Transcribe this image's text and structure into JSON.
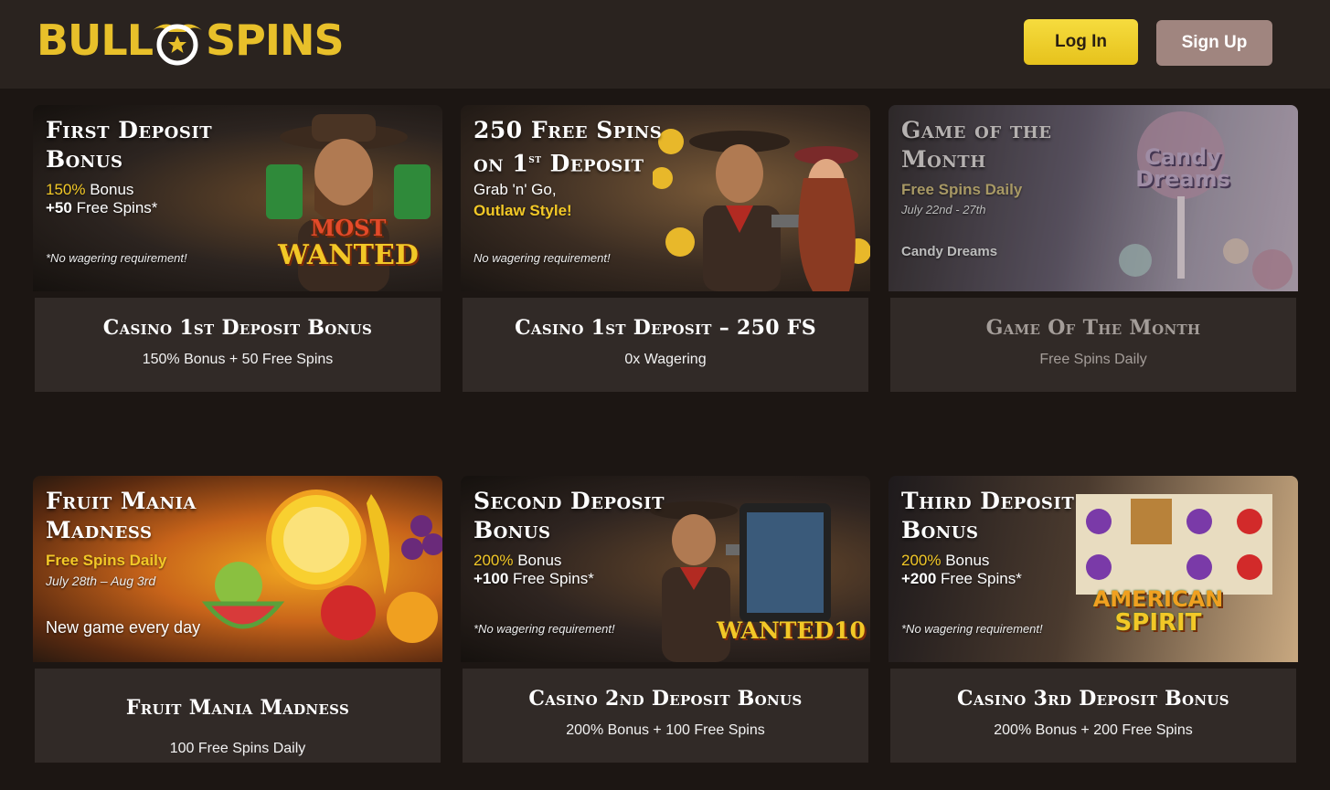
{
  "header": {
    "logo_left": "BULL",
    "logo_right": "SPINS",
    "login_label": "Log In",
    "signup_label": "Sign Up"
  },
  "colors": {
    "accent": "#f2c827",
    "background": "#1c1613",
    "header": "#2a231f",
    "card": "#312a27",
    "signup": "#a0857f"
  },
  "cards": [
    {
      "banner_title": "First Deposit\nBonus",
      "line1_gold": "150%",
      "line1_rest": " Bonus",
      "line2_bold": "+50",
      "line2_rest": " Free Spins*",
      "note": "*No wagering requirement!",
      "art_label_1": "MOST",
      "art_label_2": "WANTED",
      "info_title": "Casino 1st Deposit Bonus",
      "info_sub": "150% Bonus + 50 Free Spins"
    },
    {
      "banner_title": "250 Free Spins\non 1st Deposit",
      "line1": "Grab 'n' Go,",
      "line2": "Outlaw Style!",
      "note": "No wagering requirement!",
      "info_title": "Casino 1st Deposit – 250 FS",
      "info_sub": "0x Wagering"
    },
    {
      "banner_title": "Game of the\nMonth",
      "line1": "Free Spins Daily",
      "line2": "July  22nd - 27th",
      "line3": "Candy Dreams",
      "art_label_1": "Candy",
      "art_label_2": "Dreams",
      "info_title": "Game Of The Month",
      "info_sub": "Free Spins Daily"
    },
    {
      "banner_title": "Fruit Mania\nMadness",
      "line1": "Free Spins Daily",
      "line2": "July 28th – Aug 3rd",
      "line3": "New game every day",
      "info_title": "Fruit Mania Madness",
      "info_sub": "100 Free Spins Daily"
    },
    {
      "banner_title": "Second Deposit\nBonus",
      "line1_gold": "200%",
      "line1_rest": " Bonus",
      "line2_bold": "+100",
      "line2_rest": " Free Spins*",
      "note": "*No wagering requirement!",
      "art_label_1": "WANTED10",
      "info_title": "Casino 2nd Deposit Bonus",
      "info_sub": "200% Bonus + 100 Free Spins"
    },
    {
      "banner_title": "Third Deposit\nBonus",
      "line1_gold": "200%",
      "line1_rest": " Bonus",
      "line2_bold": "+200",
      "line2_rest": " Free Spins*",
      "note": "*No wagering requirement!",
      "art_label_1": "AMERICAN",
      "art_label_2": "SPIRIT",
      "info_title": "Casino 3rd Deposit Bonus",
      "info_sub": "200% Bonus + 200 Free Spins"
    }
  ]
}
